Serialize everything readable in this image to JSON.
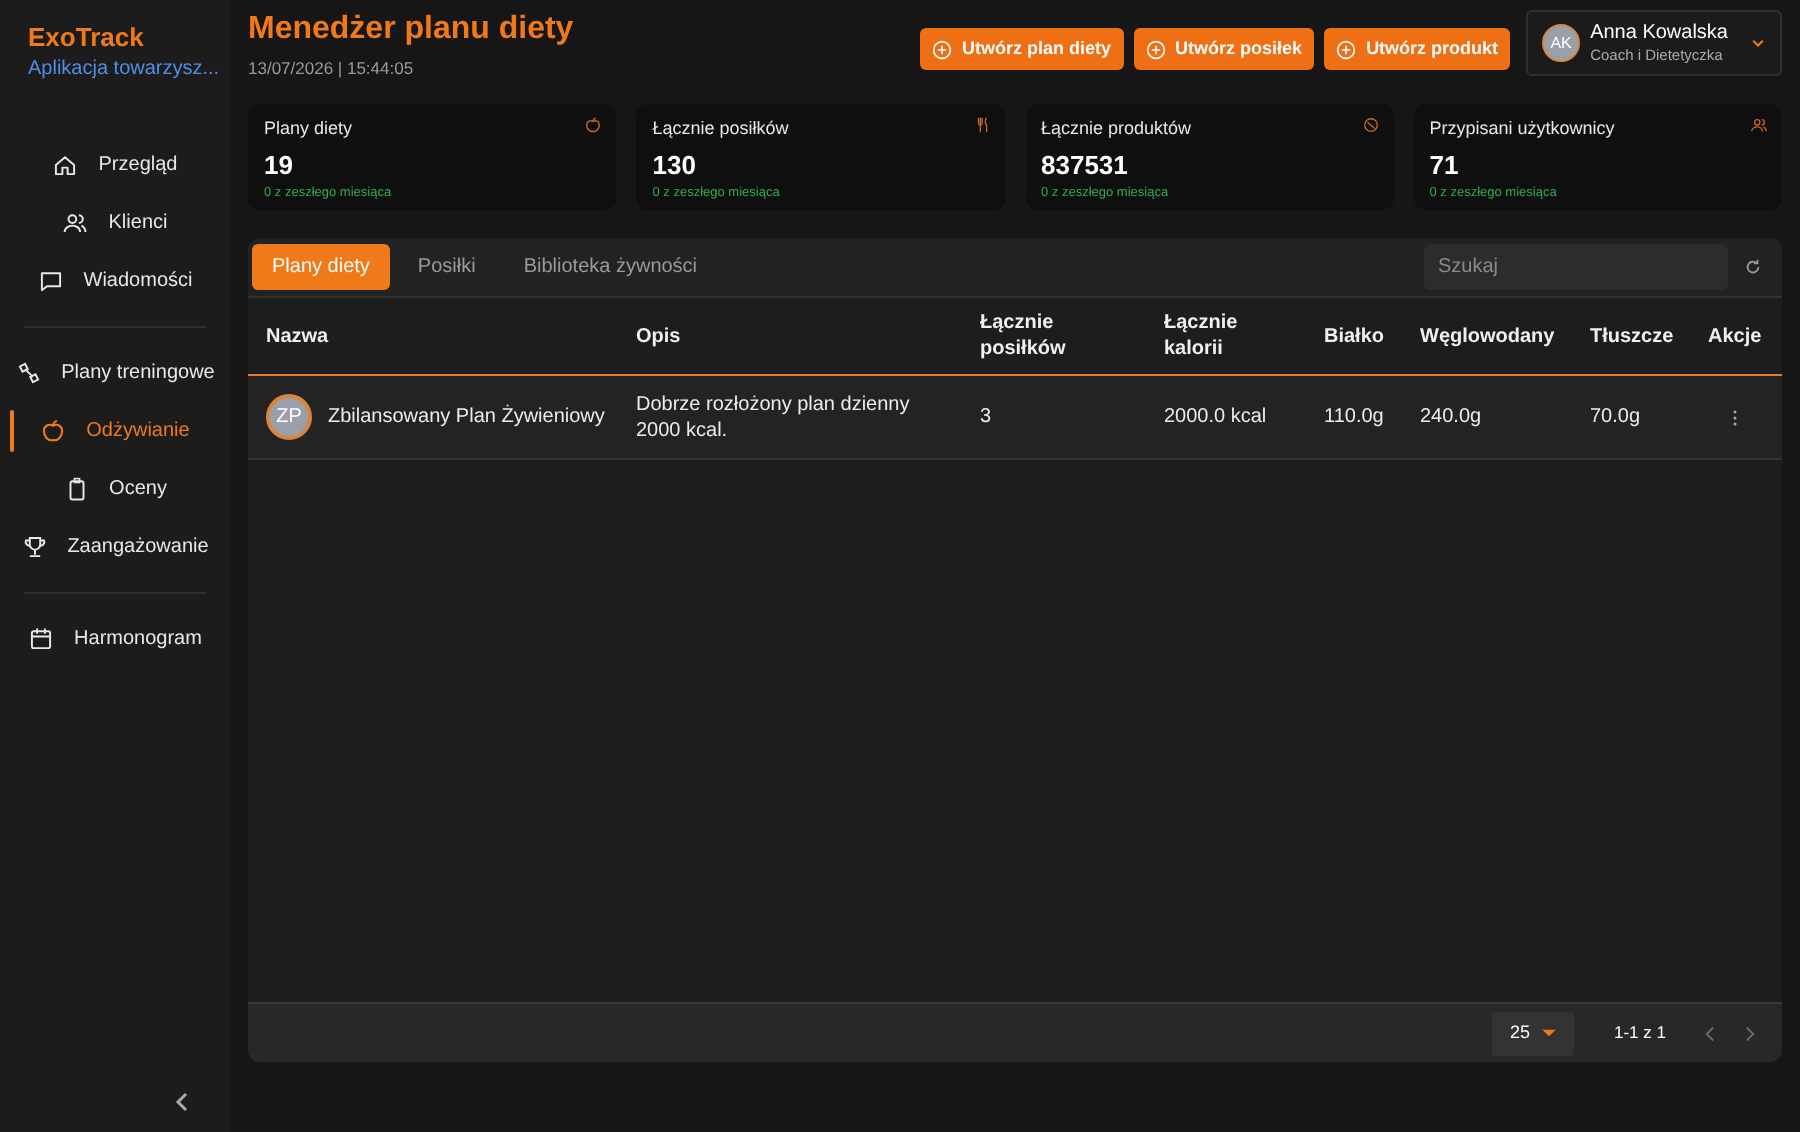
{
  "brand": {
    "name": "ExoTrack",
    "subtitle": "Aplikacja towarzysz..."
  },
  "sidebar": {
    "groups": [
      [
        {
          "label": "Przegląd",
          "selected": false
        },
        {
          "label": "Klienci",
          "selected": false
        },
        {
          "label": "Wiadomości",
          "selected": false
        }
      ],
      [
        {
          "label": "Plany treningowe",
          "selected": false
        },
        {
          "label": "Odżywianie",
          "selected": true
        },
        {
          "label": "Oceny",
          "selected": false
        },
        {
          "label": "Zaangażowanie",
          "selected": false
        }
      ],
      [
        {
          "label": "Harmonogram",
          "selected": false
        }
      ]
    ]
  },
  "header": {
    "title": "Menedżer planu diety",
    "datetime": "13/07/2026 | 15:44:05",
    "buttons": [
      "Utwórz plan diety",
      "Utwórz posiłek",
      "Utwórz produkt"
    ],
    "user": {
      "initials": "AK",
      "name": "Anna Kowalska",
      "role": "Coach i Dietetyczka"
    }
  },
  "stats": [
    {
      "label": "Plany diety",
      "value": "19",
      "change": "0 z zeszłego miesiąca"
    },
    {
      "label": "Łącznie posiłków",
      "value": "130",
      "change": "0 z zeszłego miesiąca"
    },
    {
      "label": "Łącznie produktów",
      "value": "837531",
      "change": "0 z zeszłego miesiąca"
    },
    {
      "label": "Przypisani użytkownicy",
      "value": "71",
      "change": "0 z zeszłego miesiąca"
    }
  ],
  "tabs": [
    {
      "label": "Plany diety",
      "selected": true
    },
    {
      "label": "Posiłki",
      "selected": false
    },
    {
      "label": "Biblioteka żywności",
      "selected": false
    }
  ],
  "search": {
    "placeholder": "Szukaj"
  },
  "table": {
    "columns": [
      "Nazwa",
      "Opis",
      "Łącznie posiłków",
      "Łącznie kalorii",
      "Białko",
      "Węglowodany",
      "Tłuszcze",
      "Akcje"
    ],
    "rows": [
      {
        "initials": "ZP",
        "cells": [
          "Zbilansowany Plan Żywieniowy",
          "Dobrze rozłożony plan dzienny 2000 kcal.",
          "3",
          "2000.0 kcal",
          "110.0g",
          "240.0g",
          "70.0g"
        ]
      }
    ]
  },
  "pagination": {
    "page_size": "25",
    "range": "1-1 z 1"
  }
}
